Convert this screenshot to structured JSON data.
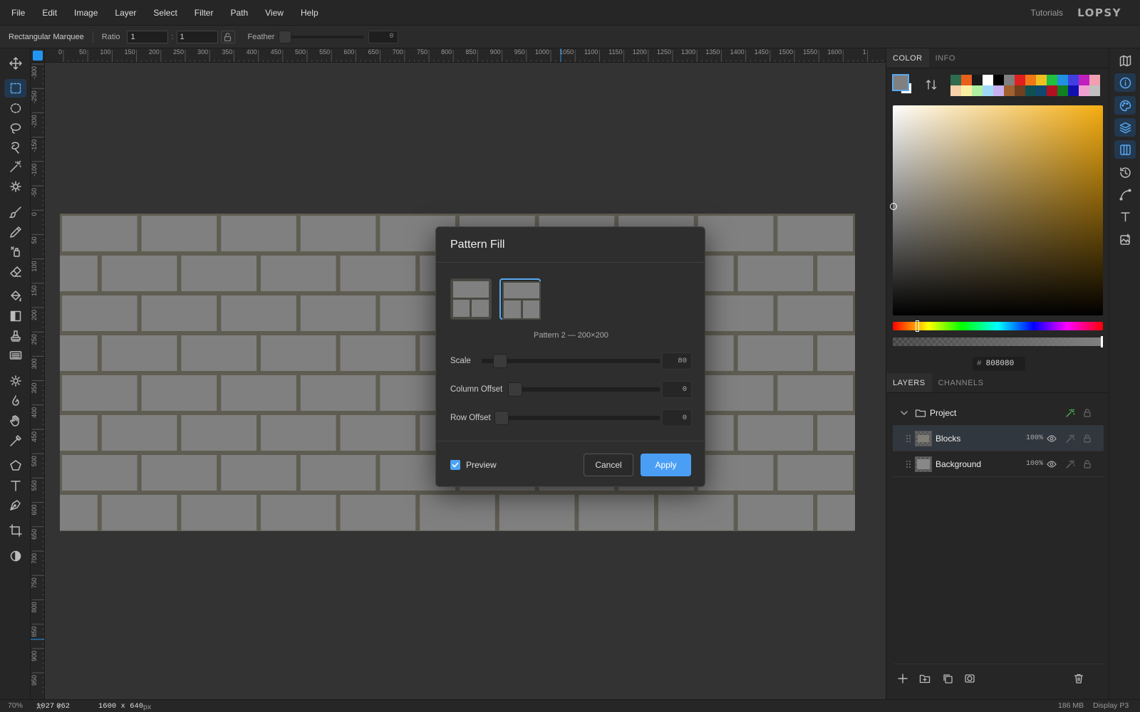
{
  "menubar": {
    "items": [
      "File",
      "Edit",
      "Image",
      "Layer",
      "Select",
      "Filter",
      "Path",
      "View",
      "Help"
    ],
    "tutorials": "Tutorials",
    "logo": "LOPSY"
  },
  "options": {
    "tool_name": "Rectangular Marquee",
    "ratio_label": "Ratio",
    "ratio_w": "1",
    "ratio_sep": ":",
    "ratio_h": "1",
    "feather_label": "Feather",
    "feather_value": "0"
  },
  "rulers": {
    "top_ticks": [
      "0",
      "50",
      "100",
      "150",
      "200",
      "250",
      "300",
      "350",
      "400",
      "450",
      "500",
      "550",
      "600",
      "650",
      "700",
      "750",
      "800",
      "850",
      "900",
      "950",
      "1000",
      "1050",
      "1100",
      "1150",
      "1200",
      "1250",
      "1300",
      "1350",
      "1400",
      "1450",
      "1500",
      "1550",
      "1600",
      "1"
    ],
    "left_ticks": [
      "-300",
      "-250",
      "-200",
      "-150",
      "-100",
      "-50",
      "0",
      "50",
      "100",
      "150",
      "200",
      "250",
      "300",
      "350",
      "400",
      "450",
      "500",
      "550",
      "600",
      "650",
      "700",
      "750",
      "800",
      "850",
      "900",
      "950"
    ]
  },
  "tools": [
    "move-icon",
    "rect-marquee-icon",
    "ellipse-marquee-icon",
    "lasso-icon",
    "object-select-icon",
    "magic-wand-icon",
    "quick-select-icon",
    "brush-icon",
    "pencil-icon",
    "clone-icon",
    "eraser-icon",
    "bucket-icon",
    "gradient-icon",
    "stamp-icon",
    "pattern-icon",
    "dodge-icon",
    "burn-icon",
    "hand-icon",
    "eyedropper-icon",
    "shape-icon",
    "text-icon",
    "pen-icon",
    "crop-icon",
    "contrast-icon"
  ],
  "dialog": {
    "title": "Pattern Fill",
    "caption": "Pattern 2 — 200×200",
    "sliders": [
      {
        "label": "Scale",
        "value": "80"
      },
      {
        "label": "Column Offset",
        "value": "0"
      },
      {
        "label": "Row Offset",
        "value": "0"
      }
    ],
    "preview_label": "Preview",
    "preview_checked": true,
    "cancel_label": "Cancel",
    "apply_label": "Apply"
  },
  "color_panel": {
    "tabs": [
      "COLOR",
      "INFO"
    ],
    "foreground": "#808080",
    "background": "#ffffff",
    "hex_prefix": "#",
    "hex": "808080",
    "hue_color": "#f5ad10",
    "swatches": [
      "#2e6b4f",
      "#e8601c",
      "#1a1a1a",
      "#ffffff",
      "#000000",
      "#808080",
      "#e02020",
      "#f07818",
      "#f0c020",
      "#20c040",
      "#2090e0",
      "#4040e0",
      "#c020c0",
      "#f0a0b0",
      "#f5d0a8",
      "#f8f0a0",
      "#b0f0a0",
      "#a0d8f8",
      "#c8b0f0",
      "#a06030",
      "#704020",
      "#105050",
      "#104870",
      "#b01020",
      "#108020",
      "#1010b0",
      "#f0a0d0",
      "#c0c0c0"
    ]
  },
  "layers_panel": {
    "tabs": [
      "LAYERS",
      "CHANNELS"
    ],
    "group": {
      "name": "Project"
    },
    "layers": [
      {
        "name": "Blocks",
        "opacity": "100%",
        "selected": true
      },
      {
        "name": "Background",
        "opacity": "100%",
        "selected": false
      }
    ]
  },
  "status": {
    "zoom": "70%",
    "x_label": "X:",
    "x": "1027",
    "y_label": "Y:",
    "y": "862",
    "doc_size": "1600 x 640",
    "unit": "px",
    "memory": "186 MB",
    "profile": "Display P3"
  }
}
